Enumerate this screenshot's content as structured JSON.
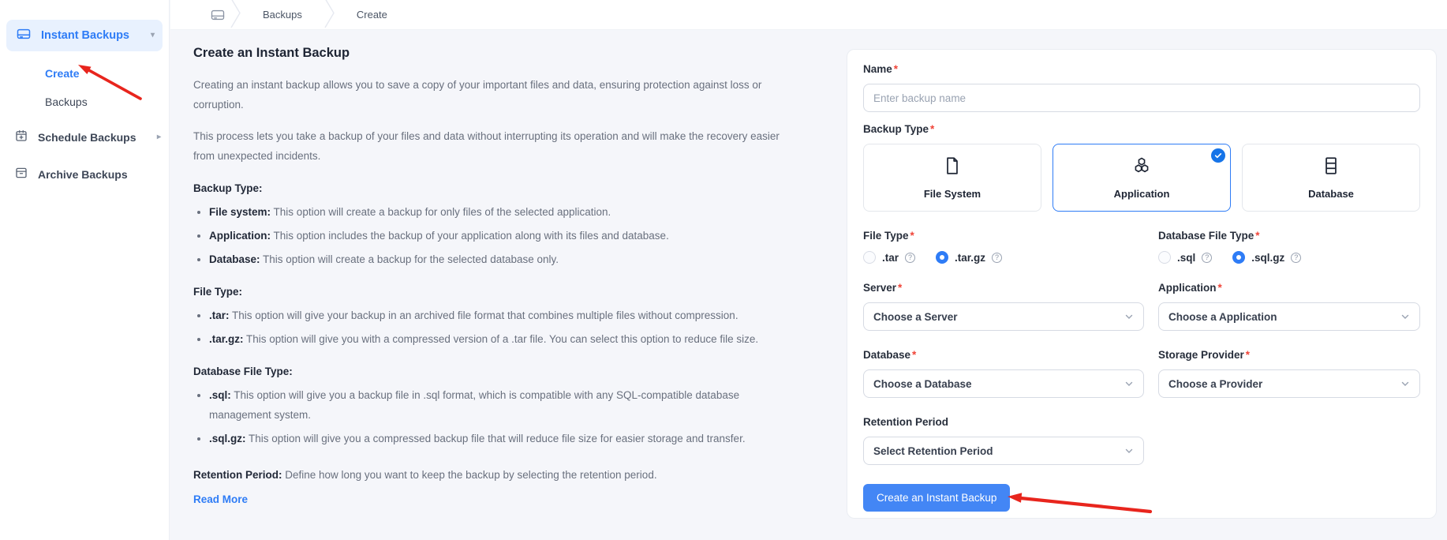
{
  "required_marker": "*",
  "glyphs": {
    "caret_down": "▾",
    "caret_right": "▸",
    "help": "?"
  },
  "colors": {
    "accent_blue": "#2e7cf6",
    "active_pill_bg": "#e8f1fe",
    "button_blue": "#4386f5",
    "badge_blue": "#1674e8",
    "annotation_red": "#e8251d",
    "background": "#f5f6fa"
  },
  "sidebar": {
    "items": {
      "instant": {
        "label": "Instant Backups",
        "icon": "drive-icon"
      },
      "create": {
        "label": "Create"
      },
      "backups": {
        "label": "Backups"
      },
      "schedule": {
        "label": "Schedule Backups",
        "icon": "calendar-plus-icon"
      },
      "archive": {
        "label": "Archive Backups",
        "icon": "archive-icon"
      }
    }
  },
  "breadcrumb": {
    "icon": "drive-icon",
    "items": [
      "Backups",
      "Create"
    ]
  },
  "content": {
    "title": "Create an Instant Backup",
    "paragraphs": [
      "Creating an instant backup allows you to save a copy of your important files and data, ensuring protection against loss or corruption.",
      "This process lets you take a backup of your files and data without interrupting its operation and will make the recovery easier from unexpected incidents."
    ],
    "sections": [
      {
        "heading": "Backup Type:",
        "bullets": [
          {
            "term": "File system:",
            "text": " This option will create a backup for only files of the selected application."
          },
          {
            "term": "Application:",
            "text": " This option includes the backup of your application along with its files and database."
          },
          {
            "term": "Database:",
            "text": " This option will create a backup for the selected database only."
          }
        ]
      },
      {
        "heading": "File Type:",
        "bullets": [
          {
            "term": ".tar:",
            "text": " This option will give your backup in an archived file format that combines multiple files without compression."
          },
          {
            "term": ".tar.gz:",
            "text": " This option will give you with a compressed version of a .tar file. You can select this option to reduce file size."
          }
        ]
      },
      {
        "heading": "Database File Type:",
        "bullets": [
          {
            "term": ".sql:",
            "text": " This option will give you a backup file in .sql format, which is compatible with any SQL-compatible database management system."
          },
          {
            "term": ".sql.gz:",
            "text": " This option will give you a compressed backup file that will reduce file size for easier storage and transfer."
          }
        ]
      }
    ],
    "retention_note": {
      "term": "Retention Period:",
      "text": " Define how long you want to keep the backup by selecting the retention period."
    },
    "read_more": "Read More"
  },
  "form": {
    "name": {
      "label": "Name",
      "placeholder": "Enter backup name"
    },
    "backup_type": {
      "label": "Backup Type",
      "options": [
        {
          "label": "File System",
          "icon": "file-icon",
          "selected": false
        },
        {
          "label": "Application",
          "icon": "cubes-icon",
          "selected": true
        },
        {
          "label": "Database",
          "icon": "database-icon",
          "selected": false
        }
      ]
    },
    "file_type": {
      "label": "File Type",
      "options": [
        {
          "label": ".tar",
          "selected": false
        },
        {
          "label": ".tar.gz",
          "selected": true
        }
      ]
    },
    "db_file_type": {
      "label": "Database File Type",
      "options": [
        {
          "label": ".sql",
          "selected": false
        },
        {
          "label": ".sql.gz",
          "selected": true
        }
      ]
    },
    "server": {
      "label": "Server",
      "value": "Choose a Server"
    },
    "application": {
      "label": "Application",
      "value": "Choose a Application"
    },
    "database": {
      "label": "Database",
      "value": "Choose a Database"
    },
    "storage_provider": {
      "label": "Storage Provider",
      "value": "Choose a Provider"
    },
    "retention_period": {
      "label": "Retention Period",
      "value": "Select Retention Period"
    },
    "submit_label": "Create an Instant Backup"
  }
}
